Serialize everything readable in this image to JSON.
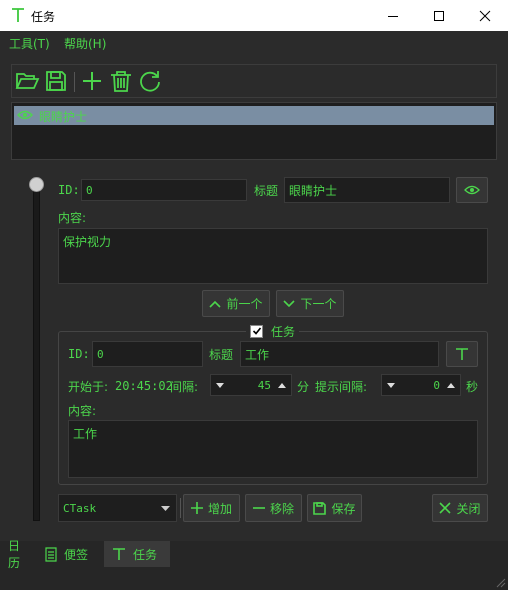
{
  "window": {
    "title": "任务"
  },
  "menu": {
    "tools": "工具(T)",
    "help": "帮助(H)"
  },
  "toolbar": {
    "buttons": [
      "folder-open-icon",
      "save-icon",
      "add-icon",
      "delete-icon",
      "refresh-icon"
    ]
  },
  "list": {
    "items": [
      {
        "label": "眼睛护士",
        "selected": true
      }
    ]
  },
  "note": {
    "id_label": "ID:",
    "id_value": "0",
    "title_label": "标题",
    "title_value": "眼睛护士",
    "content_label": "内容:",
    "content_value": "保护视力",
    "prev_label": "前一个",
    "next_label": "下一个"
  },
  "task": {
    "enabled": true,
    "group_label": "任务",
    "id_label": "ID:",
    "id_value": "0",
    "title_label": "标题",
    "title_value": "工作",
    "start_label": "开始于:",
    "start_time": "20:45:02",
    "interval_label": "间隔:",
    "interval_value": "45",
    "interval_unit": "分",
    "remind_label": "提示间隔:",
    "remind_value": "0",
    "remind_unit": "秒",
    "content_label": "内容:",
    "content_value": "工作"
  },
  "bottom": {
    "type_value": "CTask",
    "add_label": "增加",
    "remove_label": "移除",
    "save_label": "保存",
    "close_label": "关闭"
  },
  "tabs": [
    {
      "label": "日历",
      "active": false
    },
    {
      "label": "便签",
      "active": false
    },
    {
      "label": "任务",
      "active": true
    }
  ],
  "colors": {
    "accent": "#4cd64c",
    "background": "#2b2b2b",
    "field": "#1e1e1e",
    "selection": "#7a8ea3"
  }
}
